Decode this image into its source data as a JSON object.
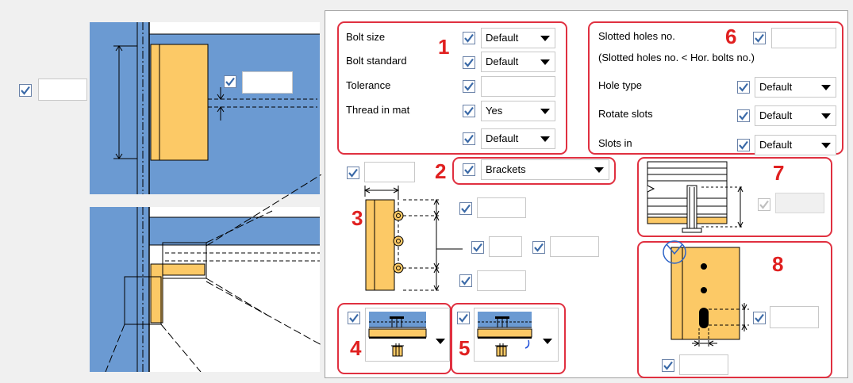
{
  "colors": {
    "steel": "#6b9ad2",
    "plate": "#fcc966",
    "callout": "#e03040",
    "check": "#3b6aa8"
  },
  "left_view": {
    "checkbox_checked": true,
    "value": "",
    "plate_checkbox_checked": true,
    "plate_value": ""
  },
  "group1": {
    "number": "1",
    "bolt_size": {
      "label": "Bolt size",
      "checked": true,
      "value": "Default"
    },
    "bolt_standard": {
      "label": "Bolt standard",
      "checked": true,
      "value": "Default"
    },
    "tolerance": {
      "label": "Tolerance",
      "checked": true,
      "value": ""
    },
    "thread_in_mat": {
      "label": "Thread in mat",
      "checked": true,
      "value": "Yes"
    },
    "extra": {
      "checked": true,
      "value": "Default"
    }
  },
  "group2": {
    "number": "2",
    "checked": true,
    "value": "Brackets"
  },
  "group3": {
    "number": "3",
    "top_value": "",
    "edge_value": "",
    "spacing_value_1": "",
    "spacing_value_2": "",
    "bottom_value": ""
  },
  "group4": {
    "number": "4",
    "checked": true
  },
  "group5": {
    "number": "5",
    "checked": true
  },
  "group6": {
    "number": "6",
    "slotted_holes": {
      "label": "Slotted holes no.",
      "checked": true,
      "value": ""
    },
    "note": "(Slotted holes no. < Hor. bolts no.)",
    "hole_type": {
      "label": "Hole type",
      "checked": true,
      "value": "Default"
    },
    "rotate_slots": {
      "label": "Rotate slots",
      "checked": true,
      "value": "Default"
    },
    "slots_in": {
      "label": "Slots in",
      "checked": true,
      "value": "Default"
    }
  },
  "group7": {
    "number": "7",
    "checked": true,
    "value": ""
  },
  "group8": {
    "number": "8",
    "slot_value": "",
    "bottom_value": ""
  }
}
